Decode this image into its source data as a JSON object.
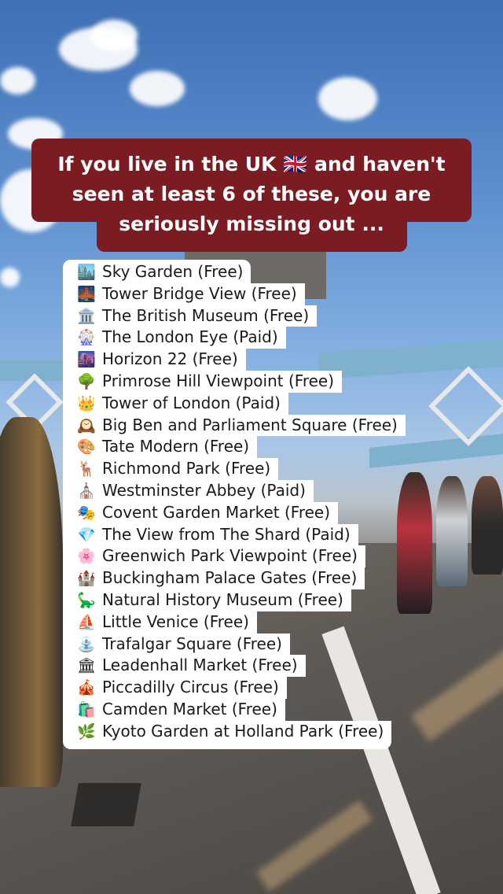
{
  "headline": "If you live in the UK 🇬🇧 and haven't seen at least 6 of these, you are seriously missing out ...",
  "attractions": [
    {
      "icon": "🏙️",
      "label": "Sky Garden (Free)"
    },
    {
      "icon": "🌉",
      "label": "Tower Bridge View (Free)"
    },
    {
      "icon": "🏛️",
      "label": "The British Museum (Free)"
    },
    {
      "icon": "🎡",
      "label": "The London Eye (Paid)"
    },
    {
      "icon": "🌆",
      "label": "Horizon 22 (Free)"
    },
    {
      "icon": "🌳",
      "label": "Primrose Hill Viewpoint (Free)"
    },
    {
      "icon": "👑",
      "label": "Tower of London (Paid)"
    },
    {
      "icon": "🕰️",
      "label": "Big Ben and Parliament Square (Free)"
    },
    {
      "icon": "🎨",
      "label": "Tate Modern (Free)"
    },
    {
      "icon": "🦌",
      "label": "Richmond Park (Free)"
    },
    {
      "icon": "⛪",
      "label": "Westminster Abbey (Paid)"
    },
    {
      "icon": "🎭",
      "label": "Covent Garden Market (Free)"
    },
    {
      "icon": "💎",
      "label": "The View from The Shard (Paid)"
    },
    {
      "icon": "🌸",
      "label": "Greenwich Park Viewpoint (Free)"
    },
    {
      "icon": "🏰",
      "label": "Buckingham Palace Gates (Free)"
    },
    {
      "icon": "🦕",
      "label": "Natural History Museum (Free)"
    },
    {
      "icon": "⛵",
      "label": "Little Venice (Free)"
    },
    {
      "icon": "⛲",
      "label": "Trafalgar Square (Free)"
    },
    {
      "icon": "🏛",
      "label": "Leadenhall Market (Free)"
    },
    {
      "icon": "🎪",
      "label": "Piccadilly Circus (Free)"
    },
    {
      "icon": "🛍️",
      "label": "Camden Market (Free)"
    },
    {
      "icon": "🌿",
      "label": "Kyoto Garden at Holland Park (Free)"
    }
  ],
  "colors": {
    "title_bg": "#7a1c22",
    "list_bg": "#ffffff"
  }
}
